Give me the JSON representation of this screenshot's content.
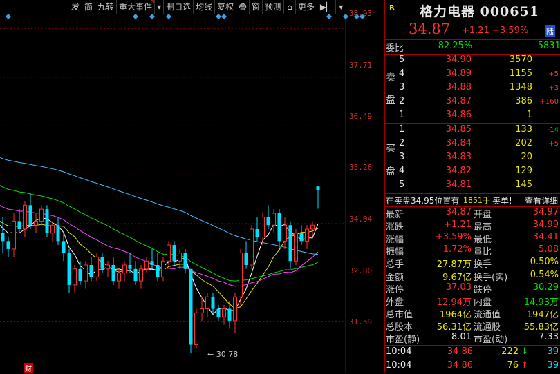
{
  "toolbar": {
    "items": [
      "发",
      "简",
      "九转",
      "重大事件",
      "▾",
      "删自选",
      "均线",
      "复权",
      "叠",
      "窗",
      "预测",
      "⌂",
      "更多",
      "▶▏",
      "▾"
    ]
  },
  "chart": {
    "y_ticks": [
      "38.93",
      "37.71",
      "36.49",
      "35.26",
      "34.04",
      "32.80",
      "31.59"
    ],
    "low_label": "30.78",
    "bottom_marker": "财",
    "colors": {
      "up": "#ff3030",
      "down": "#00e0ff",
      "ma5": "#ffffff",
      "ma10": "#e8e800",
      "ma20": "#ff40ff",
      "ma30": "#00e000",
      "ma60": "#40c0ff"
    }
  },
  "chart_data": {
    "type": "candlestick",
    "ylim": [
      30.3,
      39.3
    ],
    "candles": [
      [
        33.8,
        34.2,
        33.3,
        33.6
      ],
      [
        33.6,
        33.7,
        33.2,
        33.4
      ],
      [
        33.4,
        34.3,
        33.2,
        34.1
      ],
      [
        34.1,
        34.4,
        33.8,
        33.9
      ],
      [
        33.9,
        34.6,
        33.7,
        34.5
      ],
      [
        34.5,
        34.8,
        33.9,
        34.0
      ],
      [
        34.0,
        34.3,
        33.8,
        34.1
      ],
      [
        34.1,
        34.5,
        34.0,
        34.4
      ],
      [
        34.4,
        34.5,
        33.7,
        33.8
      ],
      [
        33.8,
        34.1,
        33.6,
        34.0
      ],
      [
        34.0,
        34.2,
        33.5,
        33.6
      ],
      [
        33.6,
        33.8,
        33.1,
        33.3
      ],
      [
        33.3,
        33.4,
        32.3,
        32.5
      ],
      [
        32.5,
        33.0,
        32.3,
        32.9
      ],
      [
        32.9,
        33.1,
        32.5,
        32.6
      ],
      [
        32.6,
        33.1,
        32.4,
        33.0
      ],
      [
        33.0,
        33.2,
        32.6,
        32.7
      ],
      [
        32.7,
        33.3,
        32.6,
        33.2
      ],
      [
        33.2,
        33.3,
        32.8,
        32.9
      ],
      [
        32.9,
        33.1,
        32.7,
        33.0
      ],
      [
        33.0,
        33.2,
        32.5,
        32.6
      ],
      [
        32.6,
        32.9,
        32.4,
        32.8
      ],
      [
        32.8,
        33.1,
        32.6,
        33.0
      ],
      [
        33.0,
        33.3,
        32.8,
        32.9
      ],
      [
        32.9,
        33.1,
        32.5,
        32.6
      ],
      [
        32.6,
        33.0,
        32.4,
        32.9
      ],
      [
        32.9,
        33.2,
        32.8,
        33.1
      ],
      [
        33.1,
        33.4,
        32.9,
        33.0
      ],
      [
        33.0,
        33.3,
        32.6,
        32.7
      ],
      [
        32.7,
        33.2,
        32.6,
        33.1
      ],
      [
        33.1,
        33.6,
        33.0,
        33.5
      ],
      [
        33.5,
        33.6,
        33.0,
        33.1
      ],
      [
        33.1,
        33.4,
        32.9,
        33.3
      ],
      [
        33.3,
        33.4,
        32.8,
        32.9
      ],
      [
        32.9,
        32.9,
        30.78,
        31.0
      ],
      [
        31.0,
        31.9,
        30.9,
        31.8
      ],
      [
        31.8,
        32.2,
        31.6,
        31.9
      ],
      [
        31.9,
        32.3,
        31.7,
        32.2
      ],
      [
        32.2,
        32.3,
        31.8,
        31.9
      ],
      [
        31.9,
        32.0,
        31.6,
        31.7
      ],
      [
        31.7,
        32.0,
        31.5,
        31.9
      ],
      [
        31.9,
        32.1,
        31.4,
        31.6
      ],
      [
        31.6,
        32.3,
        31.3,
        32.2
      ],
      [
        32.2,
        33.4,
        32.0,
        33.3
      ],
      [
        33.3,
        33.6,
        32.9,
        33.0
      ],
      [
        33.0,
        34.0,
        32.9,
        33.9
      ],
      [
        33.9,
        34.2,
        33.6,
        33.7
      ],
      [
        33.7,
        34.3,
        33.5,
        34.2
      ],
      [
        34.2,
        34.5,
        33.9,
        34.0
      ],
      [
        34.0,
        34.4,
        33.8,
        34.3
      ],
      [
        34.3,
        34.4,
        33.4,
        33.6
      ],
      [
        33.6,
        34.2,
        33.4,
        34.0
      ],
      [
        34.0,
        34.1,
        32.9,
        33.1
      ],
      [
        33.1,
        33.9,
        33.0,
        33.8
      ],
      [
        33.8,
        34.0,
        33.5,
        33.6
      ],
      [
        33.6,
        34.0,
        33.4,
        33.9
      ],
      [
        33.9,
        34.1,
        33.7,
        34.0
      ],
      [
        34.97,
        34.99,
        34.41,
        34.87
      ]
    ],
    "markers_top_index": [
      1,
      24,
      27,
      30,
      39,
      40,
      59,
      62,
      64,
      65
    ]
  },
  "panel": {
    "badge": "R",
    "title": "格力电器 000651",
    "price": "34.87",
    "change": "+1.21",
    "change_pct": "+3.59%",
    "exchange": "陆",
    "weibi_label": "委比",
    "weibi_pct": "-82.25%",
    "weibi_val": "-5831",
    "sell_label": [
      "卖",
      "盘"
    ],
    "buy_label": [
      "买",
      "盘"
    ],
    "sell": [
      {
        "lvl": "5",
        "price": "34.90",
        "vol": "3570",
        "chg": ""
      },
      {
        "lvl": "4",
        "price": "34.89",
        "vol": "1155",
        "chg": "+5"
      },
      {
        "lvl": "3",
        "price": "34.88",
        "vol": "1348",
        "chg": "+3"
      },
      {
        "lvl": "2",
        "price": "34.87",
        "vol": "386",
        "chg": "+160"
      },
      {
        "lvl": "1",
        "price": "34.86",
        "vol": "1",
        "chg": ""
      }
    ],
    "buy": [
      {
        "lvl": "1",
        "price": "34.85",
        "vol": "133",
        "chg": "-14"
      },
      {
        "lvl": "2",
        "price": "34.84",
        "vol": "202",
        "chg": "+5"
      },
      {
        "lvl": "3",
        "price": "34.83",
        "vol": "20",
        "chg": ""
      },
      {
        "lvl": "4",
        "price": "34.82",
        "vol": "129",
        "chg": ""
      },
      {
        "lvl": "5",
        "price": "34.81",
        "vol": "145",
        "chg": ""
      }
    ],
    "status_pre": "在卖盘34.95位置有",
    "status_vol": "1851手",
    "status_post": "卖单!",
    "status_link": "查看详细",
    "stats": [
      {
        "l1": "最新",
        "v1": "34.87",
        "c1": "red",
        "l2": "开盘",
        "v2": "34.97",
        "c2": "red"
      },
      {
        "l1": "涨跌",
        "v1": "+1.21",
        "c1": "red",
        "l2": "最高",
        "v2": "34.99",
        "c2": "red"
      },
      {
        "l1": "涨幅",
        "v1": "+3.59%",
        "c1": "red",
        "l2": "最低",
        "v2": "34.41",
        "c2": "red"
      },
      {
        "l1": "振幅",
        "v1": "1.72%",
        "c1": "red",
        "l2": "量比",
        "v2": "5.08",
        "c2": "red"
      },
      {
        "l1": "总手",
        "v1": "27.87万",
        "c1": "yellow",
        "l2": "换手",
        "v2": "0.50%",
        "c2": "yellow"
      },
      {
        "l1": "金额",
        "v1": "9.67亿",
        "c1": "yellow",
        "l2": "换手(实)",
        "v2": "0.54%",
        "c2": "yellow"
      },
      {
        "l1": "涨停",
        "v1": "37.03",
        "c1": "red",
        "l2": "跌停",
        "v2": "30.29",
        "c2": "green"
      },
      {
        "l1": "外盘",
        "v1": "12.94万",
        "c1": "red",
        "l2": "内盘",
        "v2": "14.93万",
        "c2": "green"
      },
      {
        "l1": "总市值",
        "v1": "1964亿",
        "c1": "yellow",
        "l2": "流通值",
        "v2": "1947亿",
        "c2": "yellow"
      },
      {
        "l1": "总股本",
        "v1": "56.31亿",
        "c1": "yellow",
        "l2": "流通股",
        "v2": "55.83亿",
        "c2": "yellow"
      },
      {
        "l1": "市盈(静)",
        "v1": "8.01",
        "c1": "white",
        "l2": "市盈(动)",
        "v2": "7.33",
        "c2": "white"
      }
    ],
    "ticks": [
      {
        "time": "10:04",
        "price": "34.86",
        "vol": "222",
        "dir": "↓",
        "cnt": "39",
        "color": "green"
      },
      {
        "time": "10:04",
        "price": "34.86",
        "vol": "76",
        "dir": "↑",
        "cnt": "39",
        "color": "red"
      }
    ]
  }
}
